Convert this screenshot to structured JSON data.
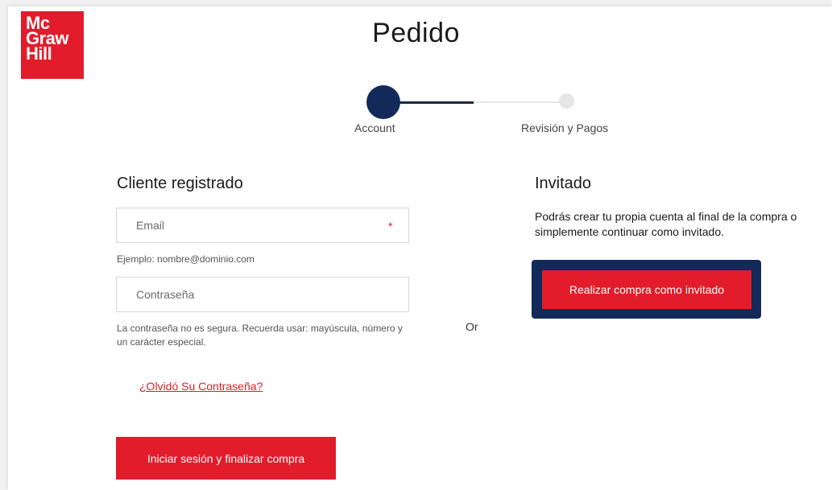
{
  "brand": {
    "logo_lines": [
      "Mc",
      "Graw",
      "Hill"
    ],
    "color": "#e31c2b"
  },
  "page": {
    "title": "Pedido"
  },
  "stepper": {
    "steps": [
      {
        "label": "Account",
        "state": "active"
      },
      {
        "label": "Revisión y Pagos",
        "state": "upcoming"
      }
    ],
    "active_color": "#13295a"
  },
  "registered": {
    "heading": "Cliente registrado",
    "email": {
      "placeholder": "Email",
      "value": "",
      "required_mark": "*",
      "hint": "Ejemplo: nombre@dominio.com"
    },
    "password": {
      "placeholder": "Contraseña",
      "value": "",
      "hint": "La contraseña no es segura. Recuerda usar: mayúscula, número y un carácter especial."
    },
    "forgot_label": "¿Olvidó Su Contraseña?",
    "submit_label": "Iniciar sesión y finalizar compra"
  },
  "separator": {
    "label": "Or"
  },
  "guest": {
    "heading": "Invitado",
    "description": "Podrás crear tu propia cuenta al final de la compra o simplemente continuar como invitado.",
    "button_label": "Realizar compra como invitado"
  }
}
